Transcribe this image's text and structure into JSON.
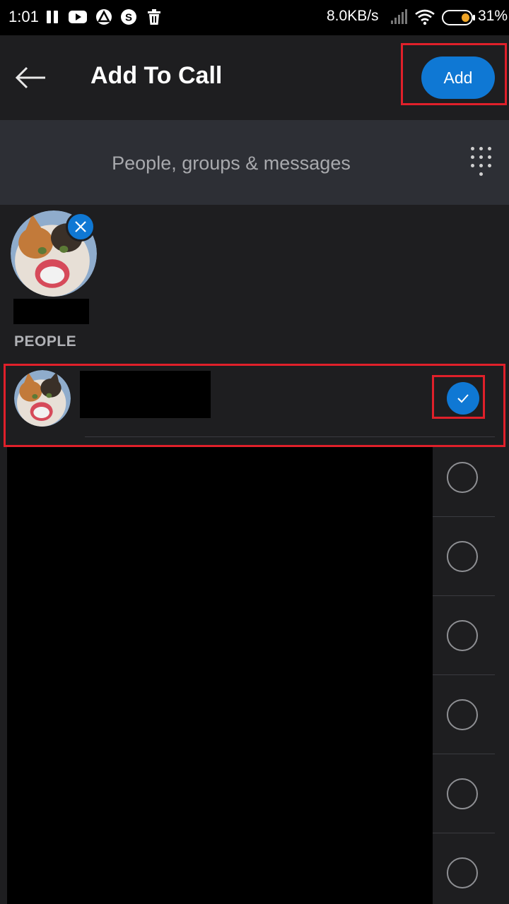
{
  "status_bar": {
    "time": "1:01",
    "net_speed": "8.0KB/s",
    "battery": "31%",
    "notification_icons": [
      "pause-icon",
      "youtube-icon",
      "app-a-icon",
      "skype-icon",
      "trash-icon"
    ],
    "system_icons": [
      "signal-icon",
      "wifi-icon",
      "battery-icon"
    ]
  },
  "header": {
    "title": "Add To Call",
    "add_label": "Add",
    "back_icon": "arrow-left-icon"
  },
  "search": {
    "placeholder": "People, groups & messages",
    "dialpad_icon": "dialpad-icon"
  },
  "selected_chip": {
    "remove_icon": "close-icon"
  },
  "people_section": {
    "label": "PEOPLE"
  },
  "contacts": [
    {
      "selected": true
    },
    {
      "selected": false
    },
    {
      "selected": false
    },
    {
      "selected": false
    },
    {
      "selected": false
    },
    {
      "selected": false
    },
    {
      "selected": false
    }
  ],
  "colors": {
    "accent": "#0f78d4",
    "background": "#1e1e20",
    "search_bg": "#2d2f35",
    "highlight_red": "#e0202a"
  }
}
